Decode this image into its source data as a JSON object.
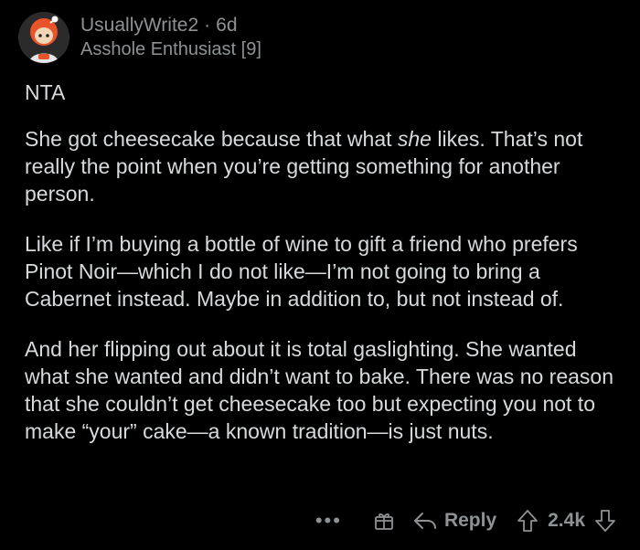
{
  "comment": {
    "username": "UsuallyWrite2",
    "separator": "·",
    "age": "6d",
    "flair": "Asshole Enthusiast [9]",
    "paragraphs": {
      "p1": "NTA",
      "p2_before": "She got cheesecake because that what ",
      "p2_emph": "she",
      "p2_after": " likes. That’s not really the point when you’re getting something for another person.",
      "p3": "Like if I’m buying a bottle of wine to gift a friend who prefers Pinot Noir—which I do not like—I’m not going to bring a Cabernet instead. Maybe in addition to, but not instead of.",
      "p4": "And her flipping out about it is total gaslighting. She wanted what she wanted and didn’t want to bake. There was no reason that she couldn’t get cheesecake too but expecting you not to make “your” cake—a known tradition—is just nuts."
    },
    "actions": {
      "more": "•••",
      "reply": "Reply",
      "score": "2.4k"
    },
    "icons": {
      "more": "more-options-icon",
      "award": "gift-award-icon",
      "reply": "reply-arrow-icon",
      "upvote": "upvote-arrow-icon",
      "downvote": "downvote-arrow-icon"
    },
    "colors": {
      "background": "#000000",
      "text": "#d7dadc",
      "muted": "#8e9294",
      "avatar_accent": "#e8532a"
    }
  }
}
